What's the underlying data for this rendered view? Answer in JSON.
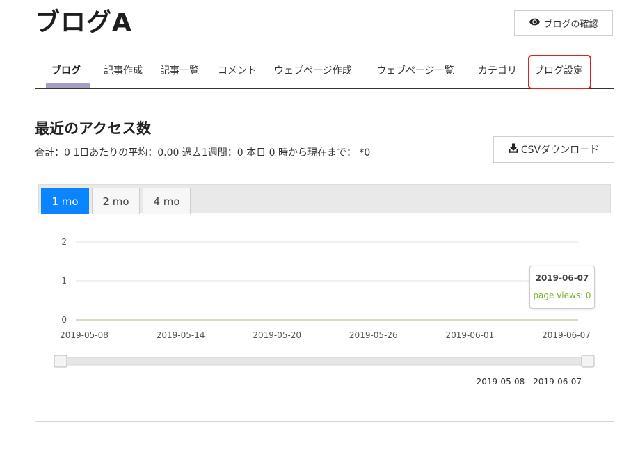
{
  "header": {
    "blog_title": "ブログA",
    "view_blog_icon": "eye-icon",
    "view_blog_label": "ブログの確認"
  },
  "nav": {
    "items": [
      {
        "label": "ブログ",
        "active": true
      },
      {
        "label": "記事作成"
      },
      {
        "label": "記事一覧"
      },
      {
        "label": "コメント"
      },
      {
        "label": "ウェブページ作成"
      },
      {
        "label": "ウェブページ一覧"
      },
      {
        "label": "カテゴリ"
      },
      {
        "label": "ブログ設定",
        "highlighted": true
      }
    ],
    "active_color": "#a69ec2",
    "highlight_color": "#e02020"
  },
  "access": {
    "title": "最近のアクセス数",
    "stats": "合計：0 1日あたりの平均：0.00 過去1週間：0 本日 0 時から現在まで： *0",
    "csv_icon": "download-icon",
    "csv_label": "CSVダウンロード"
  },
  "range_tabs": [
    {
      "label": "1 mo",
      "active": true
    },
    {
      "label": "2 mo"
    },
    {
      "label": "4 mo"
    }
  ],
  "chart_data": {
    "type": "line",
    "x": [
      "2019-05-08",
      "2019-06-07"
    ],
    "x_tick_labels": [
      "2019-05-08",
      "2019-05-14",
      "2019-05-20",
      "2019-05-26",
      "2019-06-01",
      "2019-06-07"
    ],
    "y_tick_labels": [
      "0",
      "1",
      "2"
    ],
    "ylim": [
      0,
      2
    ],
    "grid": true,
    "series": [
      {
        "values": [
          0,
          0
        ],
        "color": "#73b32e"
      }
    ],
    "tooltip": {
      "date": "2019-06-07",
      "text": "page views: 0"
    },
    "range_label": "2019-05-08 - 2019-06-07"
  },
  "colors": {
    "accent": "#0a84ff",
    "series": "#73b32e",
    "highlight": "#e02020"
  }
}
